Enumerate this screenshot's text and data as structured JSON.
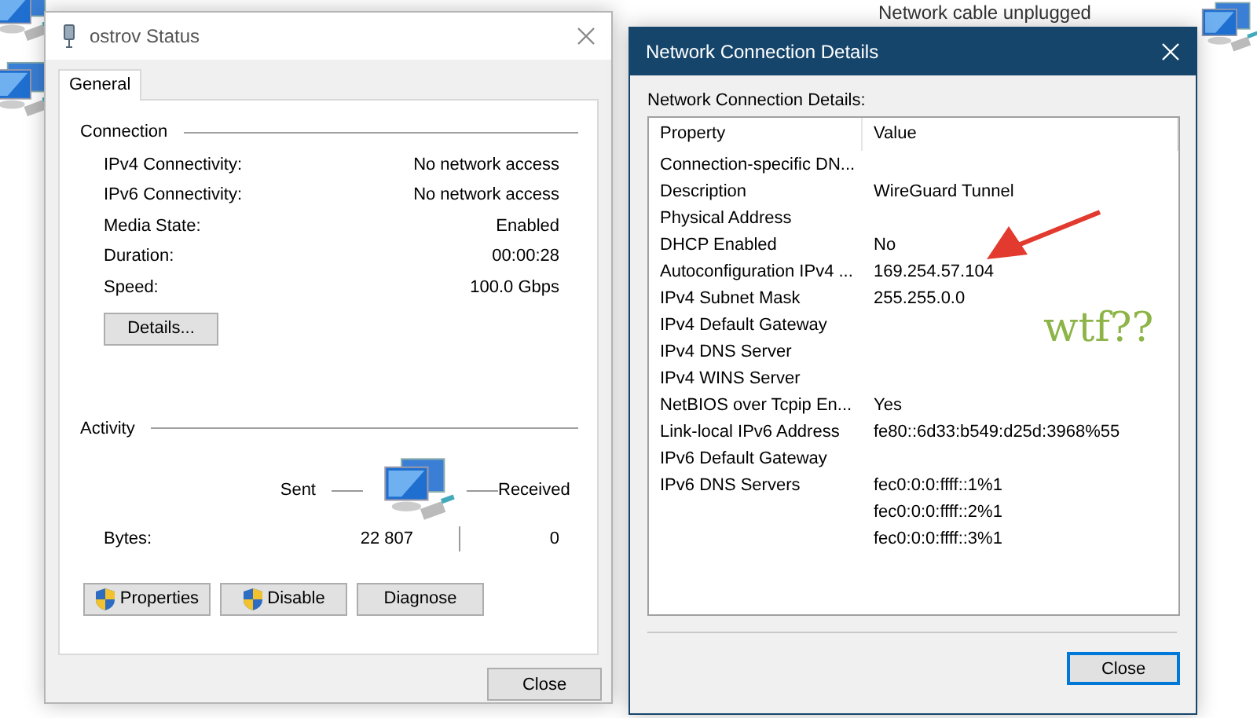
{
  "desktop": {
    "items": [
      {
        "label": "Network cable unplugged"
      }
    ]
  },
  "status_window": {
    "title": "ostrov Status",
    "tabs": [
      {
        "label": "General",
        "selected": true
      }
    ],
    "connection": {
      "heading": "Connection",
      "rows": [
        {
          "label": "IPv4 Connectivity:",
          "value": "No network access"
        },
        {
          "label": "IPv6 Connectivity:",
          "value": "No network access"
        },
        {
          "label": "Media State:",
          "value": "Enabled"
        },
        {
          "label": "Duration:",
          "value": "00:00:28"
        },
        {
          "label": "Speed:",
          "value": "100.0 Gbps"
        }
      ],
      "details_button": "Details..."
    },
    "activity": {
      "heading": "Activity",
      "sent_label": "Sent",
      "received_label": "Received",
      "bytes_label": "Bytes:",
      "sent": "22 807",
      "received": "0"
    },
    "buttons": [
      {
        "label": "Properties",
        "shield": true
      },
      {
        "label": "Disable",
        "shield": true
      },
      {
        "label": "Diagnose",
        "shield": false
      }
    ],
    "close_button": "Close"
  },
  "details_window": {
    "title": "Network Connection Details",
    "caption": "Network Connection Details:",
    "columns": [
      "Property",
      "Value"
    ],
    "rows": [
      {
        "property": "Connection-specific DN...",
        "values": []
      },
      {
        "property": "Description",
        "values": [
          "WireGuard Tunnel"
        ]
      },
      {
        "property": "Physical Address",
        "values": []
      },
      {
        "property": "DHCP Enabled",
        "values": [
          "No"
        ]
      },
      {
        "property": "Autoconfiguration IPv4 ...",
        "values": [
          "169.254.57.104"
        ]
      },
      {
        "property": "IPv4 Subnet Mask",
        "values": [
          "255.255.0.0"
        ]
      },
      {
        "property": "IPv4 Default Gateway",
        "values": []
      },
      {
        "property": "IPv4 DNS Server",
        "values": []
      },
      {
        "property": "IPv4 WINS Server",
        "values": []
      },
      {
        "property": "NetBIOS over Tcpip En...",
        "values": [
          "Yes"
        ]
      },
      {
        "property": "Link-local IPv6 Address",
        "values": [
          "fe80::6d33:b549:d25d:3968%55"
        ]
      },
      {
        "property": "IPv6 Default Gateway",
        "values": []
      },
      {
        "property": "IPv6 DNS Servers",
        "values": [
          "fec0:0:0:ffff::1%1",
          "fec0:0:0:ffff::2%1",
          "fec0:0:0:ffff::3%1"
        ]
      }
    ],
    "close_button": "Close"
  },
  "annotation": {
    "text": "wtf??"
  }
}
